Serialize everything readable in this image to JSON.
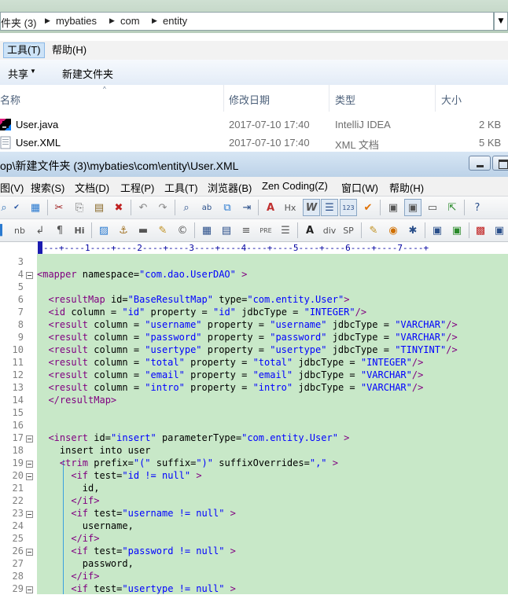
{
  "explorer": {
    "breadcrumb": [
      "件夹 (3)",
      "mybaties",
      "com",
      "entity"
    ],
    "menu": [
      {
        "label": "工具(T)",
        "active": true
      },
      {
        "label": "帮助(H)",
        "active": false
      }
    ],
    "toolbar": {
      "share_label": "共享",
      "new_folder_label": "新建文件夹"
    },
    "columns": {
      "name": "名称",
      "modified": "修改日期",
      "type": "类型",
      "size": "大小"
    },
    "files": [
      {
        "name": "User.java",
        "modified": "2017-07-10 17:40",
        "type": "IntelliJ IDEA",
        "size": "2 KB",
        "icon": "intellij-icon"
      },
      {
        "name": "User.XML",
        "modified": "2017-07-10 17:40",
        "type": "XML 文档",
        "size": "5 KB",
        "icon": "xml-file-icon"
      }
    ]
  },
  "editor": {
    "title": "op\\新建文件夹 (3)\\mybaties\\com\\entity\\User.XML",
    "menu": [
      "图(V)",
      "搜索(S)",
      "文档(D)",
      "工程(P)",
      "工具(T)",
      "浏览器(B)",
      "Zen Coding(Z)",
      "窗口(W)",
      "帮助(H)"
    ],
    "toolbar2_labels": {
      "nb": "nb",
      "hi": "Hi",
      "pre": "PRE",
      "div": "div",
      "sp": "SP",
      "hx": "Hx"
    },
    "ruler": "---+----1----+----2----+----3----+----4----+----5----+----6----+----7----+",
    "accent_color": "#c8e8c8",
    "lines": [
      {
        "n": "3",
        "segs": []
      },
      {
        "n": "4",
        "fold": true,
        "segs": [
          [
            "tg",
            "<mapper "
          ],
          [
            "at",
            "namespace="
          ],
          [
            "va",
            "\"com.dao.UserDAO\""
          ],
          [
            "tg",
            " >"
          ]
        ]
      },
      {
        "n": "5",
        "segs": []
      },
      {
        "n": "6",
        "segs": [
          [
            "tx",
            "  "
          ],
          [
            "tg",
            "<resultMap "
          ],
          [
            "at",
            "id="
          ],
          [
            "va",
            "\"BaseResultMap\""
          ],
          [
            "at",
            " type="
          ],
          [
            "va",
            "\"com.entity.User\""
          ],
          [
            "tg",
            ">"
          ]
        ]
      },
      {
        "n": "7",
        "segs": [
          [
            "tx",
            "  "
          ],
          [
            "tg",
            "<id "
          ],
          [
            "at",
            "column = "
          ],
          [
            "va",
            "\"id\""
          ],
          [
            "at",
            " property = "
          ],
          [
            "va",
            "\"id\""
          ],
          [
            "at",
            " jdbcType = "
          ],
          [
            "va",
            "\"INTEGER\""
          ],
          [
            "tg",
            "/>"
          ]
        ]
      },
      {
        "n": "8",
        "segs": [
          [
            "tx",
            "  "
          ],
          [
            "tg",
            "<result "
          ],
          [
            "at",
            "column = "
          ],
          [
            "va",
            "\"username\""
          ],
          [
            "at",
            " property = "
          ],
          [
            "va",
            "\"username\""
          ],
          [
            "at",
            " jdbcType = "
          ],
          [
            "va",
            "\"VARCHAR\""
          ],
          [
            "tg",
            "/>"
          ]
        ]
      },
      {
        "n": "9",
        "segs": [
          [
            "tx",
            "  "
          ],
          [
            "tg",
            "<result "
          ],
          [
            "at",
            "column = "
          ],
          [
            "va",
            "\"password\""
          ],
          [
            "at",
            " property = "
          ],
          [
            "va",
            "\"password\""
          ],
          [
            "at",
            " jdbcType = "
          ],
          [
            "va",
            "\"VARCHAR\""
          ],
          [
            "tg",
            "/>"
          ]
        ]
      },
      {
        "n": "10",
        "segs": [
          [
            "tx",
            "  "
          ],
          [
            "tg",
            "<result "
          ],
          [
            "at",
            "column = "
          ],
          [
            "va",
            "\"usertype\""
          ],
          [
            "at",
            " property = "
          ],
          [
            "va",
            "\"usertype\""
          ],
          [
            "at",
            " jdbcType = "
          ],
          [
            "va",
            "\"TINYINT\""
          ],
          [
            "tg",
            "/>"
          ]
        ]
      },
      {
        "n": "11",
        "segs": [
          [
            "tx",
            "  "
          ],
          [
            "tg",
            "<result "
          ],
          [
            "at",
            "column = "
          ],
          [
            "va",
            "\"total\""
          ],
          [
            "at",
            " property = "
          ],
          [
            "va",
            "\"total\""
          ],
          [
            "at",
            " jdbcType = "
          ],
          [
            "va",
            "\"INTEGER\""
          ],
          [
            "tg",
            "/>"
          ]
        ]
      },
      {
        "n": "12",
        "segs": [
          [
            "tx",
            "  "
          ],
          [
            "tg",
            "<result "
          ],
          [
            "at",
            "column = "
          ],
          [
            "va",
            "\"email\""
          ],
          [
            "at",
            " property = "
          ],
          [
            "va",
            "\"email\""
          ],
          [
            "at",
            " jdbcType = "
          ],
          [
            "va",
            "\"VARCHAR\""
          ],
          [
            "tg",
            "/>"
          ]
        ]
      },
      {
        "n": "13",
        "segs": [
          [
            "tx",
            "  "
          ],
          [
            "tg",
            "<result "
          ],
          [
            "at",
            "column = "
          ],
          [
            "va",
            "\"intro\""
          ],
          [
            "at",
            " property = "
          ],
          [
            "va",
            "\"intro\""
          ],
          [
            "at",
            " jdbcType = "
          ],
          [
            "va",
            "\"VARCHAR\""
          ],
          [
            "tg",
            "/>"
          ]
        ]
      },
      {
        "n": "14",
        "segs": [
          [
            "tx",
            "  "
          ],
          [
            "tg",
            "</resultMap>"
          ]
        ]
      },
      {
        "n": "15",
        "segs": []
      },
      {
        "n": "16",
        "segs": []
      },
      {
        "n": "17",
        "fold": true,
        "segs": [
          [
            "tx",
            "  "
          ],
          [
            "tg",
            "<insert "
          ],
          [
            "at",
            "id="
          ],
          [
            "va",
            "\"insert\""
          ],
          [
            "at",
            " parameterType="
          ],
          [
            "va",
            "\"com.entity.User\""
          ],
          [
            "tg",
            " >"
          ]
        ]
      },
      {
        "n": "18",
        "segs": [
          [
            "tx",
            "    insert into user"
          ]
        ]
      },
      {
        "n": "19",
        "fold": true,
        "segs": [
          [
            "tx",
            "    "
          ],
          [
            "tg",
            "<trim "
          ],
          [
            "at",
            "prefix="
          ],
          [
            "va",
            "\"(\""
          ],
          [
            "at",
            " suffix="
          ],
          [
            "va",
            "\")\""
          ],
          [
            "at",
            " suffixOverrides="
          ],
          [
            "va",
            "\",\""
          ],
          [
            "tg",
            " >"
          ]
        ]
      },
      {
        "n": "20",
        "fold": true,
        "segs": [
          [
            "tx",
            "      "
          ],
          [
            "tg",
            "<if "
          ],
          [
            "at",
            "test="
          ],
          [
            "va",
            "\"id != null\""
          ],
          [
            "tg",
            " >"
          ]
        ]
      },
      {
        "n": "21",
        "segs": [
          [
            "tx",
            "        id,"
          ]
        ]
      },
      {
        "n": "22",
        "segs": [
          [
            "tx",
            "      "
          ],
          [
            "tg",
            "</if>"
          ]
        ]
      },
      {
        "n": "23",
        "fold": true,
        "segs": [
          [
            "tx",
            "      "
          ],
          [
            "tg",
            "<if "
          ],
          [
            "at",
            "test="
          ],
          [
            "va",
            "\"username != null\""
          ],
          [
            "tg",
            " >"
          ]
        ]
      },
      {
        "n": "24",
        "segs": [
          [
            "tx",
            "        username,"
          ]
        ]
      },
      {
        "n": "25",
        "segs": [
          [
            "tx",
            "      "
          ],
          [
            "tg",
            "</if>"
          ]
        ]
      },
      {
        "n": "26",
        "fold": true,
        "segs": [
          [
            "tx",
            "      "
          ],
          [
            "tg",
            "<if "
          ],
          [
            "at",
            "test="
          ],
          [
            "va",
            "\"password != null\""
          ],
          [
            "tg",
            " >"
          ]
        ]
      },
      {
        "n": "27",
        "segs": [
          [
            "tx",
            "        password,"
          ]
        ]
      },
      {
        "n": "28",
        "segs": [
          [
            "tx",
            "      "
          ],
          [
            "tg",
            "</if>"
          ]
        ]
      },
      {
        "n": "29",
        "fold": true,
        "segs": [
          [
            "tx",
            "      "
          ],
          [
            "tg",
            "<if "
          ],
          [
            "at",
            "test="
          ],
          [
            "va",
            "\"usertype != null\""
          ],
          [
            "tg",
            " >"
          ]
        ]
      }
    ]
  }
}
